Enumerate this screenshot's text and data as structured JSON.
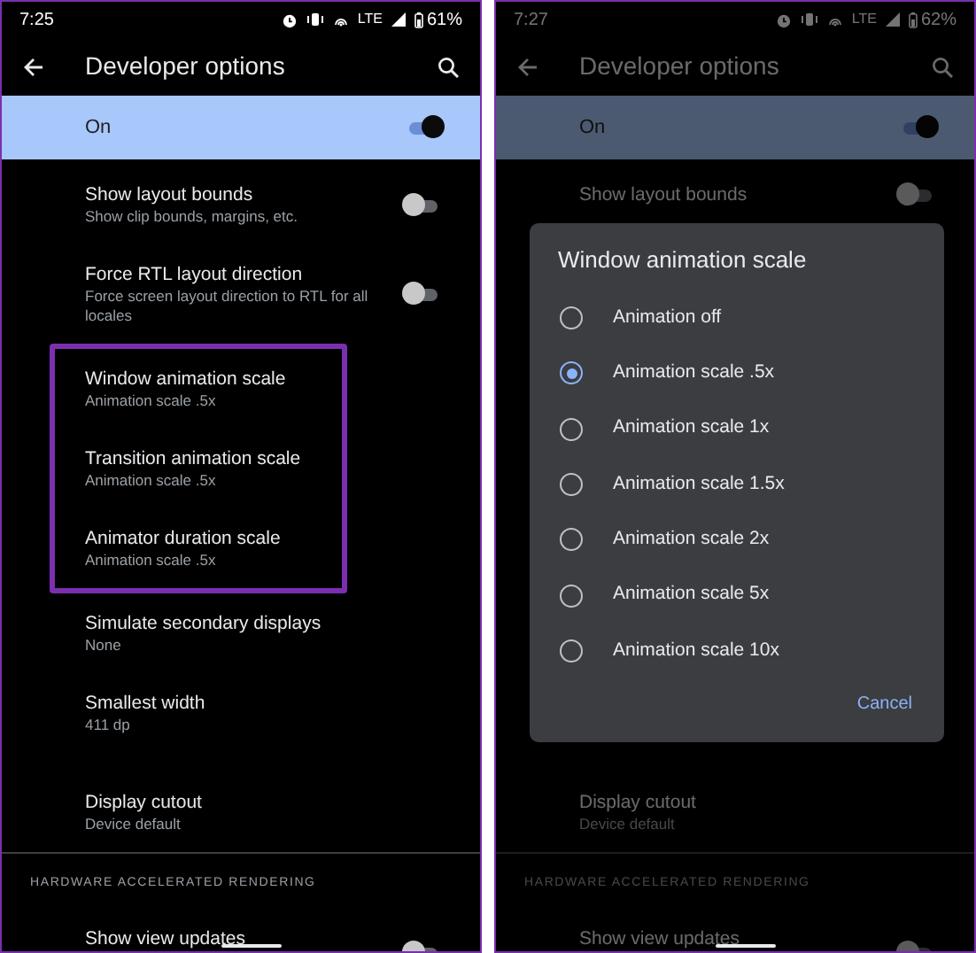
{
  "phones": [
    {
      "status_bar": {
        "time": "7:25",
        "network": "LTE",
        "battery": "61%"
      },
      "app_bar": {
        "title": "Developer options"
      },
      "dimmed": false,
      "master_switch": {
        "label": "On",
        "on": true
      },
      "rows": [
        {
          "kind": "switch",
          "title": "Show layout bounds",
          "summary": "Show clip bounds, margins, etc.",
          "on": false,
          "highlighted": false
        },
        {
          "kind": "switch",
          "title": "Force RTL layout direction",
          "summary": "Force screen layout direction to RTL for all locales",
          "on": false,
          "highlighted": false
        },
        {
          "kind": "value",
          "title": "Window animation scale",
          "summary": "Animation scale .5x",
          "highlighted": true
        },
        {
          "kind": "value",
          "title": "Transition animation scale",
          "summary": "Animation scale .5x",
          "highlighted": true
        },
        {
          "kind": "value",
          "title": "Animator duration scale",
          "summary": "Animation scale .5x",
          "highlighted": true
        },
        {
          "kind": "value",
          "title": "Simulate secondary displays",
          "summary": "None",
          "highlighted": false
        },
        {
          "kind": "value",
          "title": "Smallest width",
          "summary": "411 dp",
          "highlighted": false
        }
      ],
      "lower_rows": [
        {
          "kind": "value",
          "title": "Display cutout",
          "summary": "Device default",
          "highlighted": false
        }
      ],
      "section_header": "HARDWARE ACCELERATED RENDERING",
      "cut_row": {
        "title": "Show view updates",
        "on": false
      }
    },
    {
      "status_bar": {
        "time": "7:27",
        "network": "LTE",
        "battery": "62%"
      },
      "app_bar": {
        "title": "Developer options"
      },
      "dimmed": true,
      "master_switch": {
        "label": "On",
        "on": true
      },
      "rows": [
        {
          "kind": "switch",
          "title": "Show layout bounds",
          "on": false,
          "highlighted": false
        }
      ],
      "lower_rows": [
        {
          "kind": "value",
          "title": "Display cutout",
          "summary": "Device default",
          "highlighted": false
        }
      ],
      "section_header": "HARDWARE ACCELERATED RENDERING",
      "cut_row": {
        "title": "Show view updates",
        "on": false
      },
      "dialog": {
        "title": "Window animation scale",
        "options": [
          {
            "label": "Animation off",
            "selected": false
          },
          {
            "label": "Animation scale .5x",
            "selected": true
          },
          {
            "label": "Animation scale 1x",
            "selected": false
          },
          {
            "label": "Animation scale 1.5x",
            "selected": false
          },
          {
            "label": "Animation scale 2x",
            "selected": false
          },
          {
            "label": "Animation scale 5x",
            "selected": false
          },
          {
            "label": "Animation scale 10x",
            "selected": false
          }
        ],
        "actions": [
          "Cancel"
        ]
      }
    }
  ]
}
